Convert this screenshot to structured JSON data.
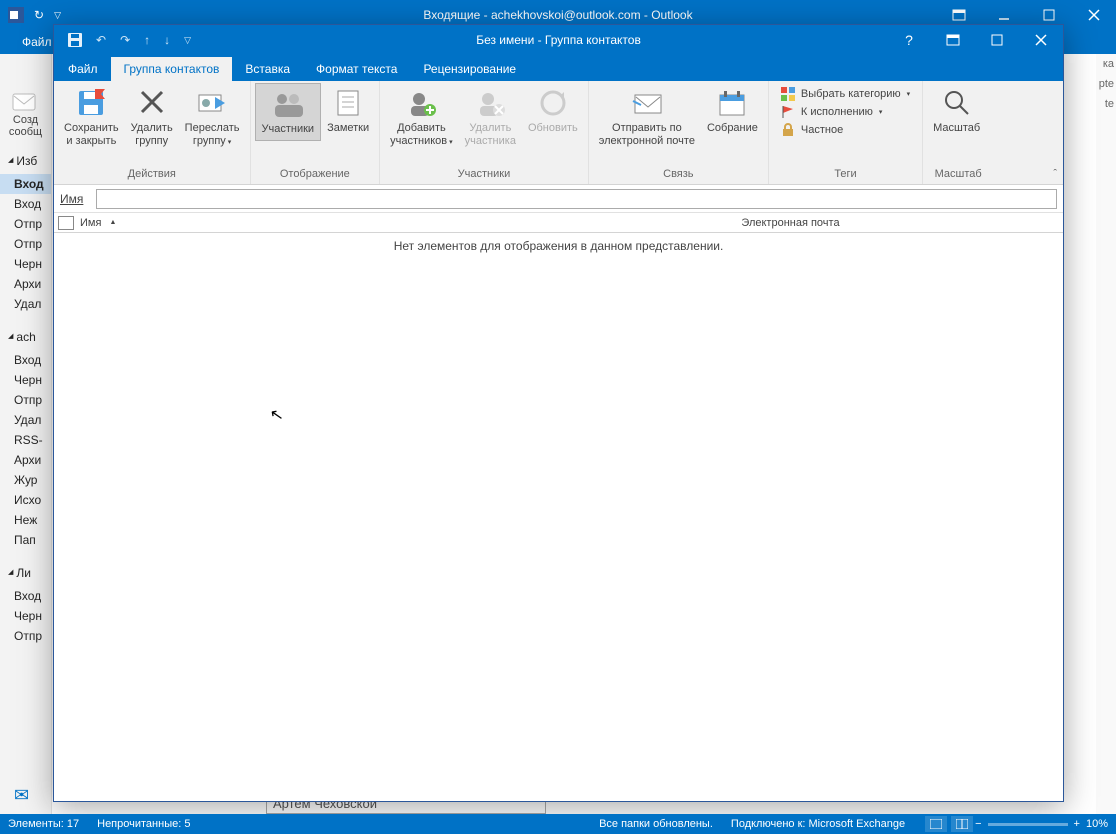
{
  "outer": {
    "title": "Входящие - achekhovskoi@outlook.com - Outlook",
    "file_tab": "Файл",
    "new_btn_l1": "Созд",
    "new_btn_l2": "сообщ",
    "nav": {
      "fav_header": "Изб",
      "fav_items": [
        "Вход",
        "Вход",
        "Отпр",
        "Отпр",
        "Черн",
        "Архи",
        "Удал"
      ],
      "fav_selected": 0,
      "acct_header": "ach",
      "acct_items": [
        "Вход",
        "Черн",
        "Отпр",
        "Удал",
        "RSS-",
        "Архи",
        "Жур",
        "Исхо",
        "Неж",
        "Пап"
      ],
      "local_header": "Ли",
      "local_items": [
        "Вход",
        "Черн",
        "Отпр"
      ]
    },
    "far_right": [
      "ка",
      "pte",
      "te"
    ],
    "reading_name": "Артем Чеховской"
  },
  "inner": {
    "title": "Без имени - Группа контактов",
    "tabs": {
      "file": "Файл",
      "group": "Группа контактов",
      "insert": "Вставка",
      "format": "Формат текста",
      "review": "Рецензирование"
    },
    "ribbon": {
      "actions": {
        "save_close_l1": "Сохранить",
        "save_close_l2": "и закрыть",
        "delete_l1": "Удалить",
        "delete_l2": "группу",
        "forward_l1": "Переслать",
        "forward_l2": "группу",
        "label": "Действия"
      },
      "display": {
        "members": "Участники",
        "notes": "Заметки",
        "label": "Отображение"
      },
      "members": {
        "add_l1": "Добавить",
        "add_l2": "участников",
        "remove_l1": "Удалить",
        "remove_l2": "участника",
        "update": "Обновить",
        "label": "Участники"
      },
      "comm": {
        "mail_l1": "Отправить по",
        "mail_l2": "электронной почте",
        "meeting": "Собрание",
        "label": "Связь"
      },
      "tags": {
        "category": "Выбрать категорию",
        "followup": "К исполнению",
        "private": "Частное",
        "label": "Теги"
      },
      "zoom": {
        "btn": "Масштаб",
        "label": "Масштаб"
      }
    },
    "name_label": "Имя",
    "list": {
      "col_name": "Имя",
      "col_email": "Электронная почта",
      "empty": "Нет элементов для отображения в данном представлении."
    }
  },
  "status": {
    "items": "Элементы: 17",
    "unread": "Непрочитанные: 5",
    "sync": "Все папки обновлены.",
    "conn": "Подключено к: Microsoft Exchange",
    "zoom": "10%"
  }
}
